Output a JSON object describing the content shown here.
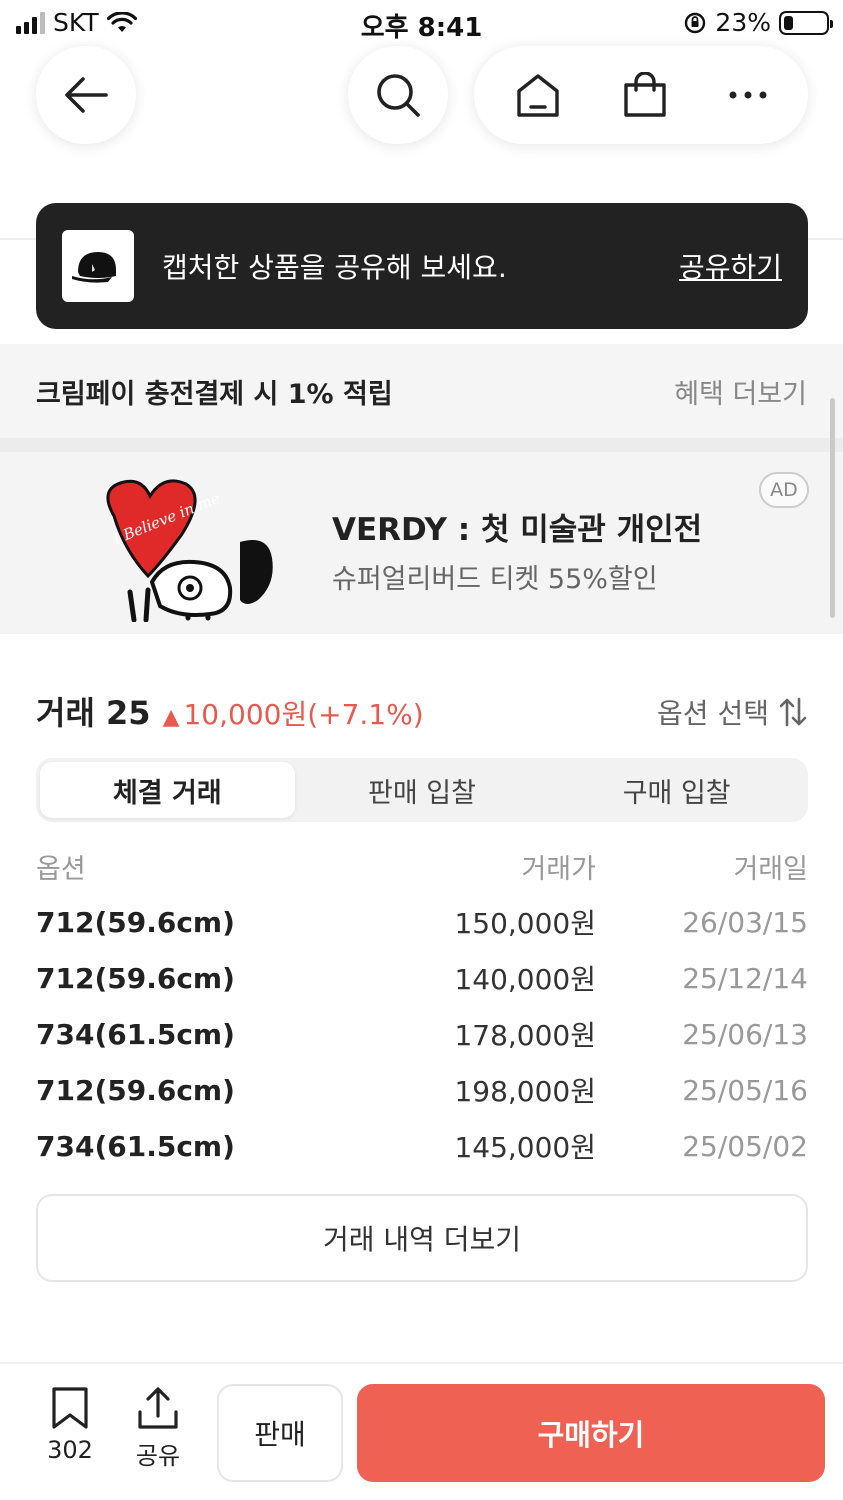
{
  "status_bar": {
    "carrier": "SKT",
    "time": "오후 8:41",
    "battery": "23%",
    "battery_level": 0.23
  },
  "toast": {
    "message": "캡처한 상품을 공유해 보세요.",
    "action": "공유하기"
  },
  "benefit": {
    "text": "크림페이 충전결제 시 1% 적립",
    "more": "혜택 더보기"
  },
  "ad": {
    "badge": "AD",
    "title": "VERDY : 첫 미술관 개인전",
    "subtitle": "슈퍼얼리버드 티켓 55%할인",
    "art_text": "I Believe in me"
  },
  "transactions": {
    "title": "거래 25",
    "change": "10,000원(+7.1%)",
    "trend_color": "#e85a4f",
    "option_select": "옵션 선택",
    "tabs": [
      {
        "label": "체결 거래",
        "active": true
      },
      {
        "label": "판매 입찰",
        "active": false
      },
      {
        "label": "구매 입찰",
        "active": false
      }
    ],
    "columns": [
      "옵션",
      "거래가",
      "거래일"
    ],
    "rows": [
      {
        "option": "712(59.6cm)",
        "price": "150,000원",
        "date": "26/03/15"
      },
      {
        "option": "712(59.6cm)",
        "price": "140,000원",
        "date": "25/12/14"
      },
      {
        "option": "734(61.5cm)",
        "price": "178,000원",
        "date": "25/06/13"
      },
      {
        "option": "712(59.6cm)",
        "price": "198,000원",
        "date": "25/05/16"
      },
      {
        "option": "734(61.5cm)",
        "price": "145,000원",
        "date": "25/05/02"
      }
    ],
    "more_button": "거래 내역 더보기"
  },
  "bottom_bar": {
    "bookmark_count": "302",
    "share_label": "공유",
    "sell_label": "판매",
    "buy_label": "구매하기",
    "buy_color": "#ef6253"
  }
}
